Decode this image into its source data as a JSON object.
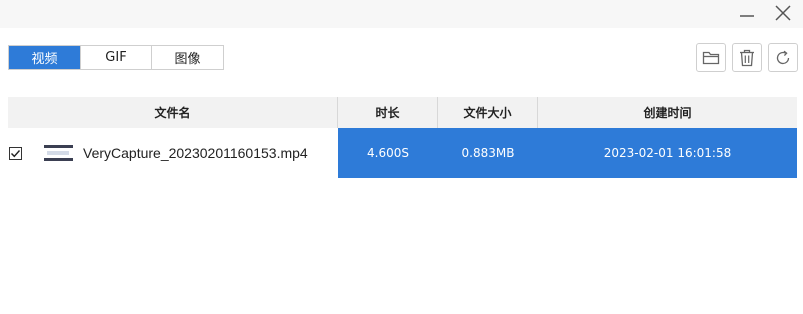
{
  "window": {
    "minimize_icon": "minimize-icon",
    "close_icon": "close-icon"
  },
  "tabs": [
    {
      "label": "视频",
      "active": true
    },
    {
      "label": "GIF",
      "active": false
    },
    {
      "label": "图像",
      "active": false
    }
  ],
  "toolbar": {
    "open_folder_icon": "folder-icon",
    "delete_icon": "trash-icon",
    "refresh_icon": "refresh-icon"
  },
  "table": {
    "columns": {
      "name": "文件名",
      "duration": "时长",
      "size": "文件大小",
      "created": "创建时间"
    },
    "rows": [
      {
        "checked": true,
        "name": "VeryCapture_20230201160153.mp4",
        "duration": "4.600S",
        "size": "0.883MB",
        "created": "2023-02-01 16:01:58"
      }
    ]
  },
  "colors": {
    "accent": "#2e7bd8",
    "header_bg": "#f2f2f2",
    "titlebar_bg": "#f7f7f7"
  }
}
